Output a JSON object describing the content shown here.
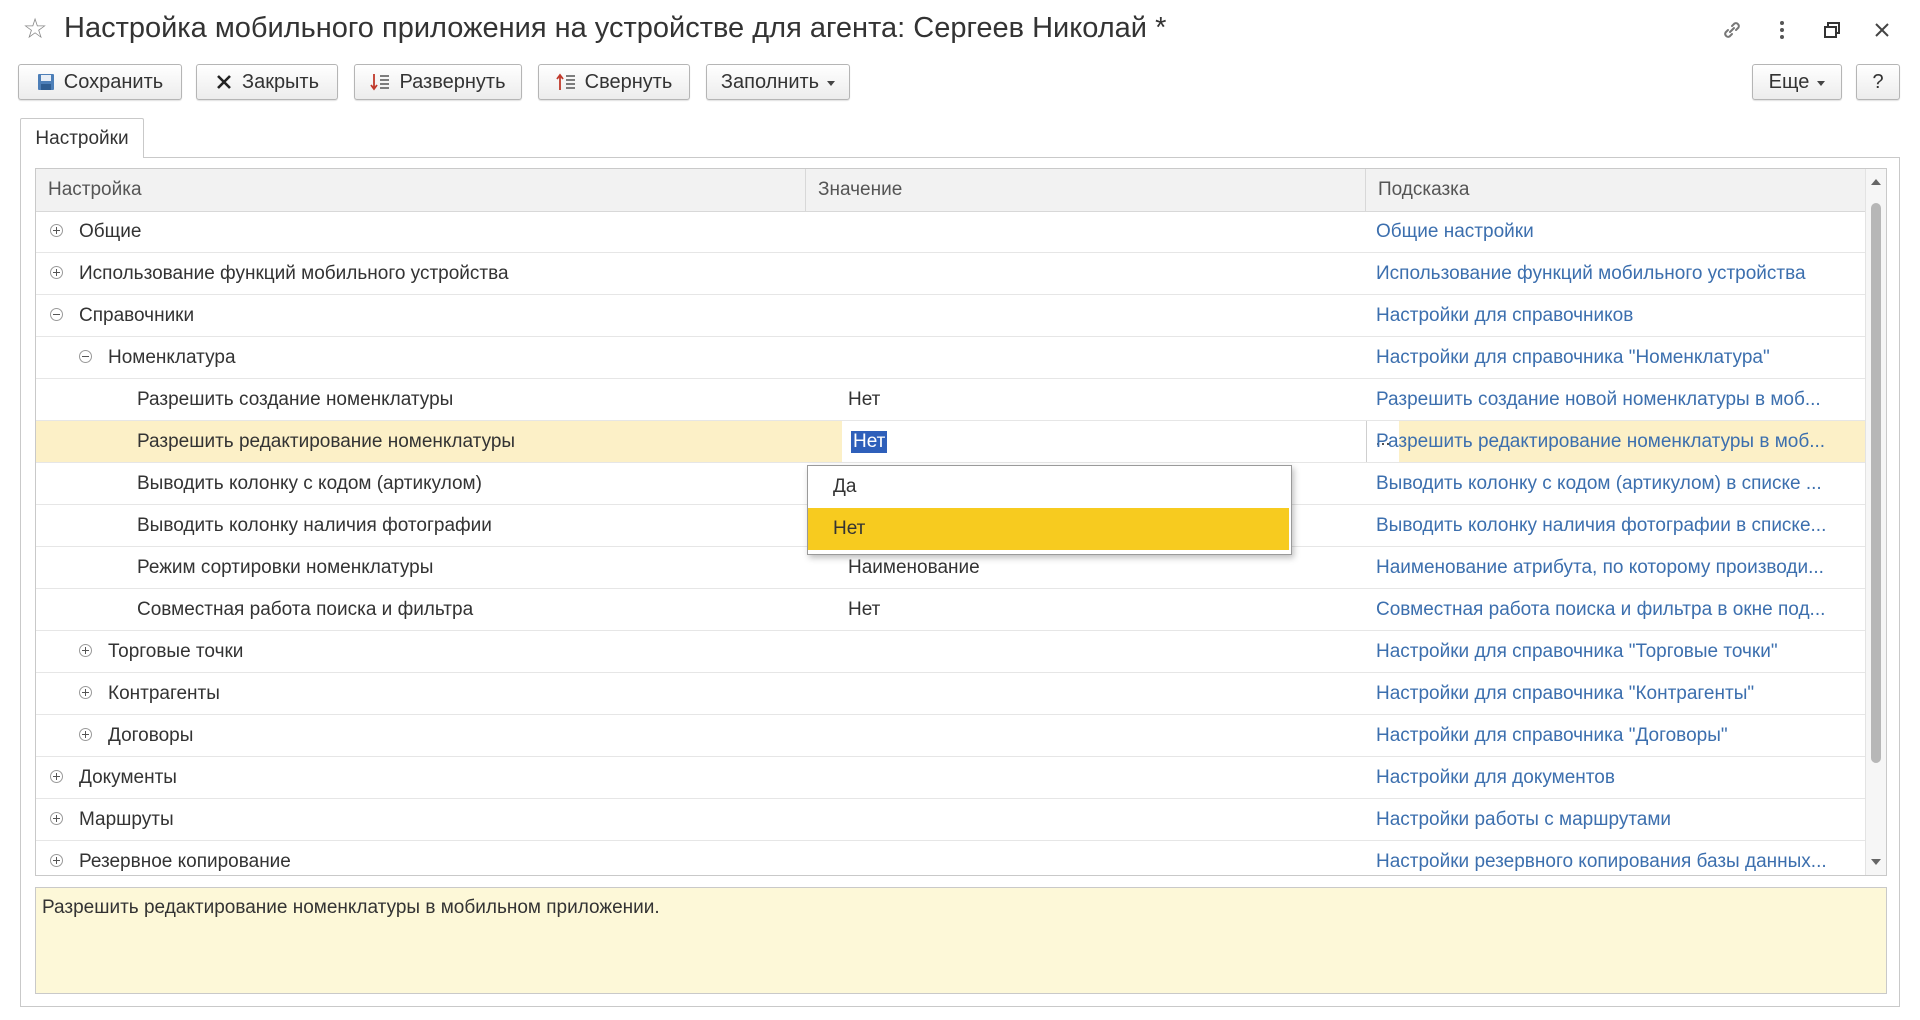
{
  "window": {
    "title": "Настройка мобильного приложения на устройстве для агента: Сергеев Николай *",
    "icons": [
      "star-icon",
      "link-icon",
      "more-vertical-icon",
      "restore-icon",
      "close-icon"
    ]
  },
  "toolbar": {
    "save_label": "Сохранить",
    "close_label": "Закрыть",
    "expand_label": "Развернуть",
    "collapse_label": "Свернуть",
    "fill_label": "Заполнить",
    "more_label": "Еще",
    "help_label": "?"
  },
  "tabs": [
    {
      "label": "Настройки"
    }
  ],
  "grid": {
    "columns": {
      "name": "Настройка",
      "value": "Значение",
      "hint": "Подсказка"
    },
    "rows": [
      {
        "name": "Общие",
        "value": "",
        "hint": "Общие настройки",
        "toggle": "plus"
      },
      {
        "name": "Использование функций мобильного устройства",
        "value": "",
        "hint": "Использование функций мобильного устройства",
        "toggle": "plus"
      },
      {
        "name": "Справочники",
        "value": "",
        "hint": "Настройки для справочников",
        "toggle": "minus"
      },
      {
        "name": "Номенклатура",
        "value": "",
        "hint": "Настройки для справочника \"Номенклатура\"",
        "toggle": "minus"
      },
      {
        "name": "Разрешить создание номенклатуры",
        "value": "Нет",
        "hint": "Разрешить создание новой номенклатуры в моб..."
      },
      {
        "name": "Разрешить редактирование номенклатуры",
        "value": "Нет",
        "hint": "Разрешить редактирование номенклатуры в моб..."
      },
      {
        "name": "Выводить колонку с кодом (артикулом)",
        "value": "",
        "hint": "Выводить колонку с кодом (артикулом) в списке ..."
      },
      {
        "name": "Выводить колонку наличия фотографии",
        "value": "",
        "hint": "Выводить колонку наличия фотографии в списке..."
      },
      {
        "name": "Режим сортировки номенклатуры",
        "value": "Наименование",
        "hint": "Наименование атрибута, по которому производи..."
      },
      {
        "name": "Совместная работа поиска и фильтра",
        "value": "Нет",
        "hint": "Совместная работа поиска и фильтра в окне под..."
      },
      {
        "name": "Торговые точки",
        "value": "",
        "hint": "Настройки для справочника \"Торговые точки\"",
        "toggle": "plus"
      },
      {
        "name": "Контрагенты",
        "value": "",
        "hint": "Настройки для справочника \"Контрагенты\"",
        "toggle": "plus"
      },
      {
        "name": "Договоры",
        "value": "",
        "hint": "Настройки для справочника \"Договоры\"",
        "toggle": "plus"
      },
      {
        "name": "Документы",
        "value": "",
        "hint": "Настройки для документов",
        "toggle": "plus"
      },
      {
        "name": "Маршруты",
        "value": "",
        "hint": "Настройки работы с маршрутами",
        "toggle": "plus"
      },
      {
        "name": "Резервное копирование",
        "value": "",
        "hint": "Настройки резервного копирования базы данных...",
        "toggle": "plus"
      }
    ],
    "selected_row": 5,
    "edit_button": "..."
  },
  "dropdown": {
    "options": [
      {
        "label": "Да"
      },
      {
        "label": "Нет"
      }
    ],
    "highlighted": 1
  },
  "hint_text": "Разрешить редактирование номенклатуры в мобильном приложении.",
  "colors": {
    "accent_link": "#3c6fae",
    "selected_row": "#fcf0c7",
    "dropdown_highlight": "#f7cb1f",
    "hint_background": "#fdf8d8",
    "text_selection": "#2e5fba"
  }
}
